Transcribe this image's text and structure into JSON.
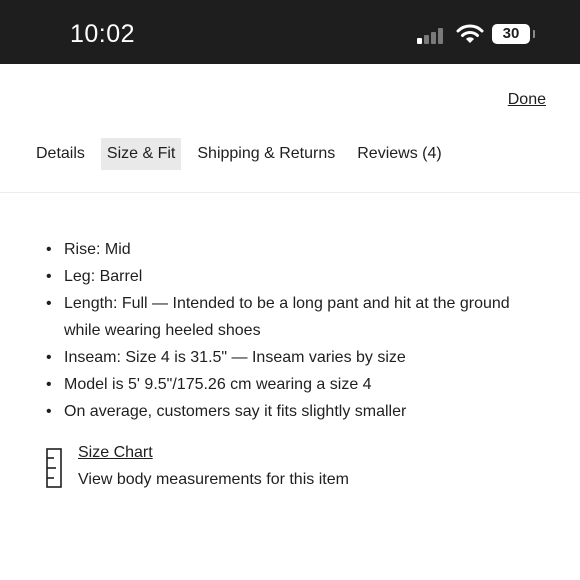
{
  "status_bar": {
    "time": "10:02",
    "battery": "30",
    "icons": [
      "signal-icon",
      "wifi-icon",
      "battery-icon"
    ]
  },
  "header": {
    "done_label": "Done"
  },
  "tabs": [
    {
      "label": "Details",
      "active": false
    },
    {
      "label": "Size & Fit",
      "active": true
    },
    {
      "label": "Shipping & Returns",
      "active": false
    },
    {
      "label": "Reviews (4)",
      "active": false
    }
  ],
  "fit_details": [
    "Rise: Mid",
    "Leg: Barrel",
    "Length: Full — Intended to be a long pant and hit at the ground while wearing heeled shoes",
    "Inseam: Size 4 is 31.5\" — Inseam varies by size",
    "Model is 5' 9.5\"/175.26 cm wearing a size 4",
    "On average, customers say it fits slightly smaller"
  ],
  "size_chart": {
    "icon": "ruler-icon",
    "link_label": "Size Chart",
    "description": "View body measurements for this item"
  },
  "colors": {
    "status_bar_bg": "#1e1e1e",
    "active_tab_bg": "#e9e9e9",
    "text": "#1f1f1f"
  }
}
